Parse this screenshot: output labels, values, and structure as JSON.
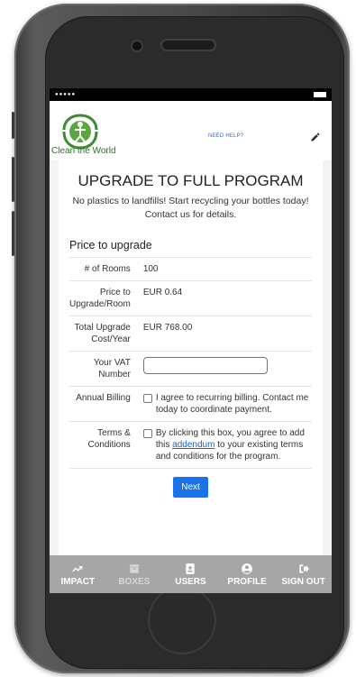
{
  "status_bar": {
    "signal": "●●●●●"
  },
  "header": {
    "logo_text": "Clean the World",
    "help_link": "NEED HELP?",
    "edit_icon": "pencil-icon"
  },
  "page": {
    "title": "UPGRADE TO FULL PROGRAM",
    "intro": "No plastics to landfills! Start recycling your bottles today! Contact us for details.",
    "section_title": "Price to upgrade"
  },
  "form": {
    "rooms": {
      "label": "# of Rooms",
      "value": "100"
    },
    "price_per_room": {
      "label": "Price to Upgrade/Room",
      "value": "EUR 0.64"
    },
    "total_cost": {
      "label": "Total Upgrade Cost/Year",
      "value": "EUR 768.00"
    },
    "vat": {
      "label": "Your VAT Number",
      "value": ""
    },
    "billing": {
      "label": "Annual Billing",
      "text": "I agree to recurring billing. Contact me today to coordinate payment.",
      "checked": false
    },
    "terms": {
      "label": "Terms & Conditions",
      "text_before": "By clicking this box, you agree to add this ",
      "link_text": "addendum",
      "text_after": " to your existing terms and conditions for the program.",
      "checked": false
    },
    "next_label": "Next"
  },
  "tabs": [
    {
      "label": "IMPACT",
      "icon": "trending-up-icon",
      "active": true
    },
    {
      "label": "BOXES",
      "icon": "archive-box-icon",
      "active": false
    },
    {
      "label": "USERS",
      "icon": "contact-card-icon",
      "active": true
    },
    {
      "label": "PROFILE",
      "icon": "user-circle-icon",
      "active": true
    },
    {
      "label": "SIGN OUT",
      "icon": "sign-out-icon",
      "active": true
    }
  ],
  "colors": {
    "brand_green": "#2e6f2a",
    "link_blue": "#1a5fcf",
    "button_blue": "#1a73e8",
    "tabbar_gray": "#a6a6a6"
  }
}
